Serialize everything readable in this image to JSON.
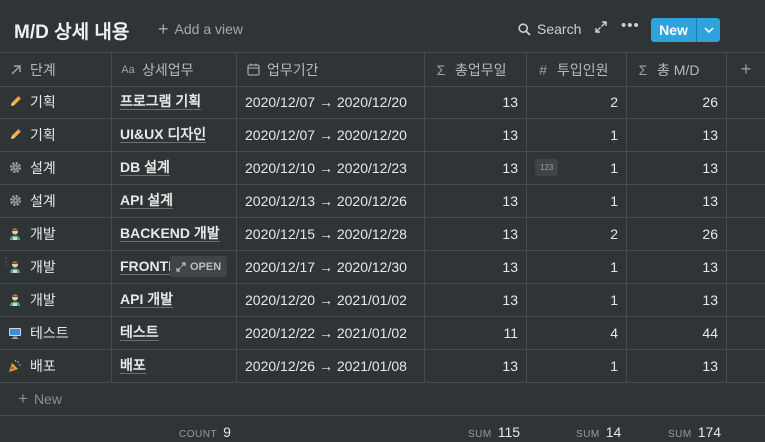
{
  "title": "M/D 상세 내용",
  "add_view_label": "Add a view",
  "search_label": "Search",
  "new_button_label": "New",
  "columns": [
    {
      "label": "단계",
      "icon": "arrow-up-right-icon"
    },
    {
      "label": "상세업무",
      "icon": "text-property-icon"
    },
    {
      "label": "업무기간",
      "icon": "calendar-icon"
    },
    {
      "label": "총업무일",
      "icon": "sigma-icon"
    },
    {
      "label": "투입인원",
      "icon": "hash-icon"
    },
    {
      "label": "총 M/D",
      "icon": "sigma-icon"
    }
  ],
  "rows": [
    {
      "stage_icon": "pencil-icon",
      "stage": "기획",
      "task": "프로그램 기획",
      "period": "2020/12/07 → 2020/12/20",
      "days": "13",
      "people": "2",
      "md": "26"
    },
    {
      "stage_icon": "pencil-icon",
      "stage": "기획",
      "task": "UI&UX 디자인",
      "period": "2020/12/07 → 2020/12/20",
      "days": "13",
      "people": "1",
      "md": "13"
    },
    {
      "stage_icon": "gear-icon",
      "stage": "설계",
      "task": "DB 설계",
      "period": "2020/12/10 → 2020/12/23",
      "days": "13",
      "people": "1",
      "md": "13"
    },
    {
      "stage_icon": "gear-icon",
      "stage": "설계",
      "task": "API 설계",
      "period": "2020/12/13 → 2020/12/26",
      "days": "13",
      "people": "1",
      "md": "13"
    },
    {
      "stage_icon": "developer-icon",
      "stage": "개발",
      "task": "BACKEND 개발",
      "period": "2020/12/15 → 2020/12/28",
      "days": "13",
      "people": "2",
      "md": "26"
    },
    {
      "stage_icon": "developer-icon",
      "stage": "개발",
      "task": "FRONTI",
      "period": "2020/12/17 → 2020/12/30",
      "days": "13",
      "people": "1",
      "md": "13"
    },
    {
      "stage_icon": "developer-icon",
      "stage": "개발",
      "task": "API 개발",
      "period": "2020/12/20 → 2021/01/02",
      "days": "13",
      "people": "1",
      "md": "13"
    },
    {
      "stage_icon": "computer-icon",
      "stage": "테스트",
      "task": "테스트",
      "period": "2020/12/22 → 2021/01/02",
      "days": "11",
      "people": "4",
      "md": "44"
    },
    {
      "stage_icon": "party-popper-icon",
      "stage": "배포",
      "task": "배포",
      "period": "2020/12/26 → 2021/01/08",
      "days": "13",
      "people": "1",
      "md": "13"
    }
  ],
  "number_badge": "123",
  "open_label": "OPEN",
  "new_row_label": "New",
  "footer": {
    "count_key": "COUNT",
    "count_val": "9",
    "sum1_key": "SUM",
    "sum1_val": "115",
    "sum2_key": "SUM",
    "sum2_val": "14",
    "sum3_key": "SUM",
    "sum3_val": "174"
  },
  "colors": {
    "background": "#2f3437",
    "accent": "#2ea3dc",
    "grid": "#474c50"
  }
}
